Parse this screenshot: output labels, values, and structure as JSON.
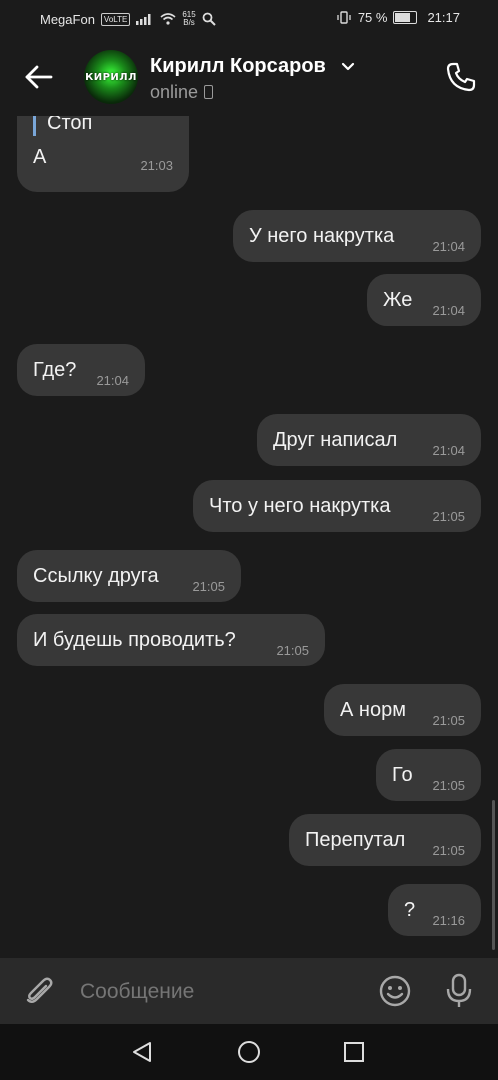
{
  "status_bar": {
    "carrier": "MegaFon",
    "volte": "VoLTE",
    "speed_value": "615",
    "speed_unit": "B/s",
    "battery": "75 %",
    "time": "21:17"
  },
  "header": {
    "contact_name": "Кирилл Корсаров",
    "status": "online",
    "avatar_text": "КИРИЛЛ"
  },
  "messages": [
    {
      "quote": "Стоп",
      "text": "А",
      "time": "21:03"
    },
    {
      "text": "У него накрутка",
      "time": "21:04"
    },
    {
      "text": "Же",
      "time": "21:04"
    },
    {
      "text": "Где?",
      "time": "21:04"
    },
    {
      "text": "Друг написал",
      "time": "21:04"
    },
    {
      "text": "Что у него накрутка",
      "time": "21:05"
    },
    {
      "text": "Ссылку друга",
      "time": "21:05"
    },
    {
      "text": "И будешь проводить?",
      "time": "21:05"
    },
    {
      "text": "А норм",
      "time": "21:05"
    },
    {
      "text": "Го",
      "time": "21:05"
    },
    {
      "text": "Перепутал",
      "time": "21:05"
    },
    {
      "text": "?",
      "time": "21:16"
    }
  ],
  "composer": {
    "placeholder": "Сообщение"
  }
}
